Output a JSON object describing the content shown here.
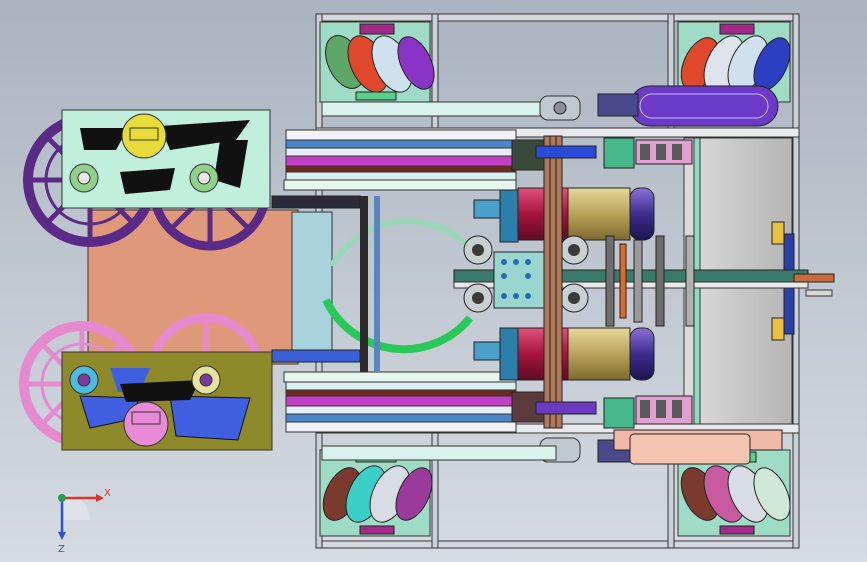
{
  "colors": {
    "background": "#c3cad3",
    "frame": "#9aa3ad",
    "mint_plate": "#bfeedd",
    "olive_plate": "#8e8a2a",
    "copper_panel": "#e2987a",
    "motor_gold": "#c8b46a",
    "motor_red": "#b01d50",
    "purple_wheel": "#5b2d86",
    "pink_wheel": "#e58ad0",
    "lavender_pod": "#7a3fd0",
    "axis_x": "#e0302a",
    "axis_y": "#22a04a",
    "axis_z": "#2b4fd8"
  },
  "axis": {
    "x_label": "X",
    "z_label": "Z"
  }
}
